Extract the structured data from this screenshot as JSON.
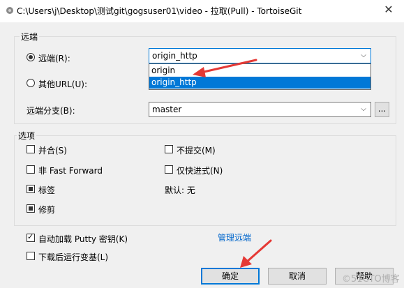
{
  "window": {
    "title": "C:\\Users\\j\\Desktop\\测试git\\gogsuser01\\video - 拉取(Pull) - TortoiseGit",
    "close_label": "✕"
  },
  "remote_group": {
    "label": "远端",
    "remote_radio_label": "远端(R):",
    "remote_selected": "origin_http",
    "dropdown_options": [
      "origin",
      "origin_http"
    ],
    "other_url_label": "其他URL(U):",
    "remote_branch_label": "远端分支(B):",
    "remote_branch_value": "master",
    "ellipsis_label": "..."
  },
  "options_group": {
    "label": "选项",
    "merge_label": "并合(S)",
    "no_commit_label": "不提交(M)",
    "non_ff_label": "非 Fast Forward",
    "ff_only_label": "仅快进式(N)",
    "tags_label": "标签",
    "default_label": "默认: 无",
    "prune_label": "修剪"
  },
  "bottom": {
    "putty_label": "自动加载 Putty 密钥(K)",
    "manage_remotes_link": "管理远端",
    "run_rebase_label": "下载后运行变基(L)",
    "ok_label": "确定",
    "cancel_label": "取消",
    "help_label": "帮助"
  },
  "watermark": "©51CTO博客",
  "colors": {
    "accent": "#0078d7",
    "annotation_arrow": "#e53935"
  }
}
